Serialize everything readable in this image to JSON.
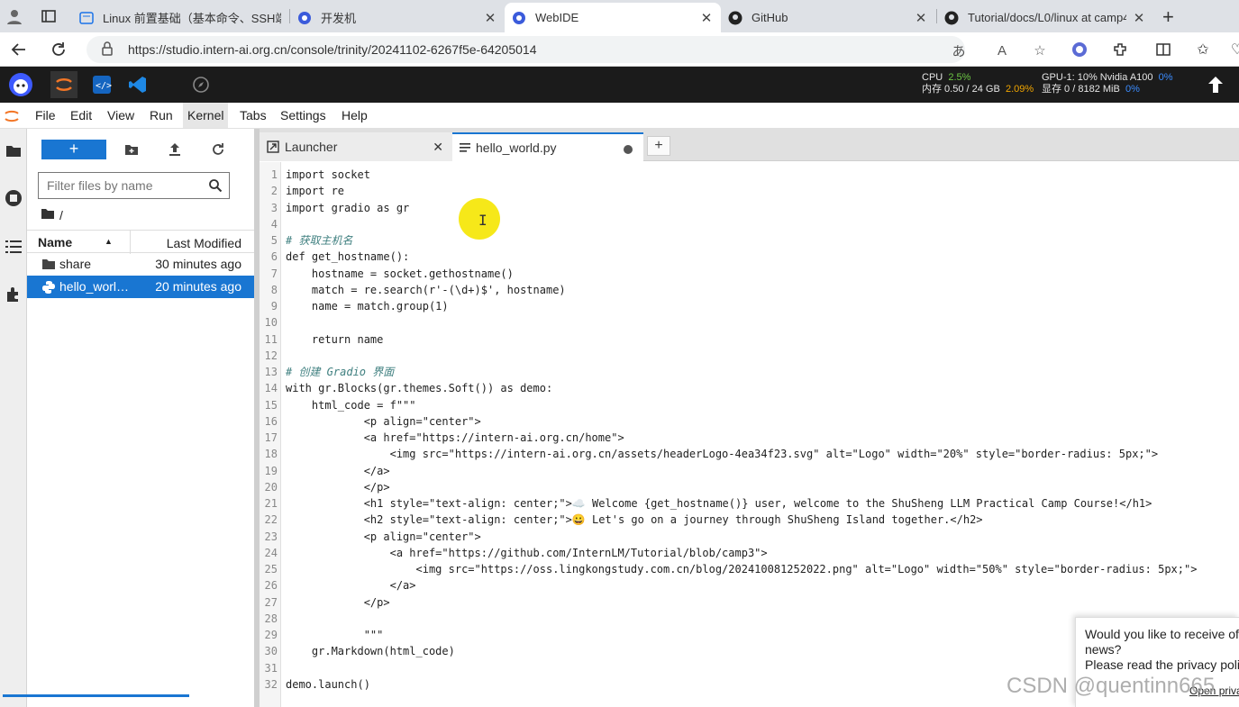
{
  "browser": {
    "tabs": [
      {
        "title": "Linux 前置基础（基本命令、SSH端",
        "icon": "tab-doc-icon"
      },
      {
        "title": "开发机",
        "icon": "intern-icon"
      },
      {
        "title": "WebIDE",
        "icon": "intern-icon",
        "active": true
      },
      {
        "title": "GitHub",
        "icon": "github-icon"
      },
      {
        "title": "Tutorial/docs/L0/linux at camp4 ·",
        "icon": "github-icon"
      }
    ],
    "url": "https://studio.intern-ai.org.cn/console/trinity/20241102-6267f5e-64205014"
  },
  "appbar": {
    "cpu_label": "CPU",
    "cpu_value": "2.5%",
    "mem_text": "内存 0.50 / 24 GB",
    "mem_value": "2.09%",
    "gpu_label": "GPU-1: 10% Nvidia A100",
    "gpu_value": "0%",
    "vram_text": "显存 0 / 8182 MiB",
    "vram_value": "0%"
  },
  "menu": [
    "File",
    "Edit",
    "View",
    "Run",
    "Kernel",
    "Tabs",
    "Settings",
    "Help"
  ],
  "filebrowser": {
    "new_label": "+",
    "filter_placeholder": "Filter files by name",
    "breadcrumb": "/",
    "col_name": "Name",
    "col_modified": "Last Modified",
    "files": [
      {
        "name": "share",
        "modified": "30 minutes ago",
        "type": "folder"
      },
      {
        "name": "hello_world.py",
        "modified": "20 minutes ago",
        "type": "python",
        "selected": true
      }
    ]
  },
  "editor_tabs": [
    {
      "label": "Launcher"
    },
    {
      "label": "hello_world.py",
      "active": true,
      "modified": true
    }
  ],
  "code_lines": [
    "import socket",
    "import re",
    "import gradio as gr",
    "",
    "# 获取主机名",
    "def get_hostname():",
    "    hostname = socket.gethostname()",
    "    match = re.search(r'-(\\d+)$', hostname)",
    "    name = match.group(1)",
    "",
    "    return name",
    "",
    "# 创建 Gradio 界面",
    "with gr.Blocks(gr.themes.Soft()) as demo:",
    "    html_code = f\"\"\"",
    "            <p align=\"center\">",
    "            <a href=\"https://intern-ai.org.cn/home\">",
    "                <img src=\"https://intern-ai.org.cn/assets/headerLogo-4ea34f23.svg\" alt=\"Logo\" width=\"20%\" style=\"border-radius: 5px;\">",
    "            </a>",
    "            </p>",
    "            <h1 style=\"text-align: center;\">☁️ Welcome {get_hostname()} user, welcome to the ShuSheng LLM Practical Camp Course!</h1>",
    "            <h2 style=\"text-align: center;\">😀 Let's go on a journey through ShuSheng Island together.</h2>",
    "            <p align=\"center\">",
    "                <a href=\"https://github.com/InternLM/Tutorial/blob/camp3\">",
    "                    <img src=\"https://oss.lingkongstudy.com.cn/blog/202410081252022.png\" alt=\"Logo\" width=\"50%\" style=\"border-radius: 5px;\">",
    "                </a>",
    "            </p>",
    "",
    "            \"\"\"",
    "    gr.Markdown(html_code)",
    "",
    "demo.launch()"
  ],
  "popup": {
    "line1": "Would you like to receive of",
    "line2": "news?",
    "line3": "Please read the privacy poli",
    "link": "Open priva"
  },
  "watermark": "CSDN @quentinn665"
}
